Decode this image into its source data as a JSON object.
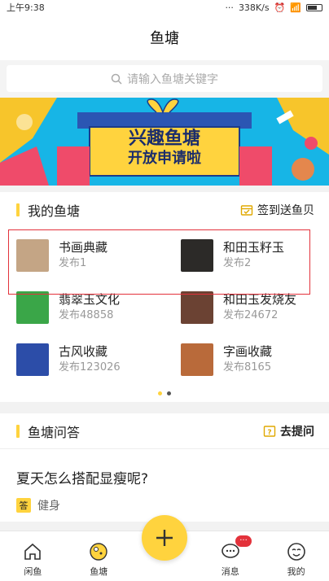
{
  "statusbar": {
    "time": "上午9:38",
    "dots": "···",
    "speed": "338K/s"
  },
  "nav": {
    "title": "鱼塘"
  },
  "search": {
    "placeholder": "请输入鱼塘关键字"
  },
  "banner": {
    "line1": "兴趣鱼塘",
    "line2": "开放申请啦"
  },
  "my_ponds": {
    "title": "我的鱼塘",
    "action": "签到送鱼贝",
    "items": [
      {
        "name": "书画典藏",
        "meta": "发布1",
        "color": "#c4a585"
      },
      {
        "name": "和田玉籽玉",
        "meta": "发布2",
        "color": "#2c2a28"
      },
      {
        "name": "翡翠玉文化",
        "meta": "发布48858",
        "color": "#3aa648"
      },
      {
        "name": "和田玉发烧友",
        "meta": "发布24672",
        "color": "#6b4233"
      },
      {
        "name": "古风收藏",
        "meta": "发布123026",
        "color": "#2c4da8"
      },
      {
        "name": "字画收藏",
        "meta": "发布8165",
        "color": "#b96a3a"
      }
    ]
  },
  "qa": {
    "title": "鱼塘问答",
    "action": "去提问",
    "question": "夏天怎么搭配显瘦呢?",
    "tag_badge": "答",
    "tag": "健身"
  },
  "tabbar": {
    "tabs": [
      {
        "label": "闲鱼"
      },
      {
        "label": "鱼塘"
      },
      {
        "label": "消息",
        "badge": "···"
      },
      {
        "label": "我的"
      }
    ]
  },
  "colors": {
    "accent": "#ffd33e",
    "highlight": "#e3323b",
    "banner_bg": "#17b5e6"
  }
}
